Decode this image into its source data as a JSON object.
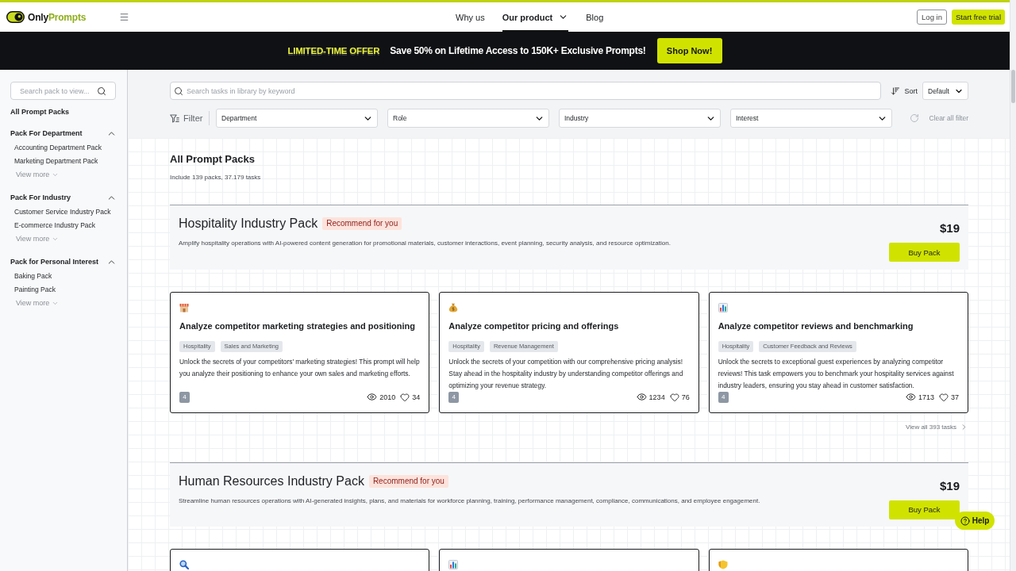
{
  "header": {
    "logo": [
      "Only",
      "Prompts"
    ],
    "nav": [
      {
        "label": "Why us",
        "kind": "link",
        "selected": false
      },
      {
        "label": "Our product",
        "kind": "menu",
        "selected": true
      },
      {
        "label": "Blog",
        "kind": "link",
        "selected": false
      }
    ],
    "login": "Log in",
    "trial": "Start free trial"
  },
  "banner": {
    "offer": "LIMITED-TIME OFFER",
    "message": "Save 50% on Lifetime Access to 150K+ Exclusive Prompts!",
    "button": "Shop Now!"
  },
  "sidebar": {
    "search": {
      "placeholder": "Search pack to view..."
    },
    "all_label": "All Prompt Packs",
    "groups": [
      {
        "title": "Pack For Department",
        "expanded": true,
        "items": [
          "Accounting Department Pack",
          "Marketing Department Pack"
        ],
        "more": "View more"
      },
      {
        "title": "Pack For Industry",
        "expanded": true,
        "items": [
          "Customer Service Industry Pack",
          "E-commerce Industry Pack"
        ],
        "more": "View more"
      },
      {
        "title": "Pack for Personal Interest",
        "expanded": true,
        "items": [
          "Baking Pack",
          "Painting Pack"
        ],
        "more": "View more"
      }
    ]
  },
  "filters": {
    "search": {
      "placeholder": "Search tasks in library by keyword"
    },
    "sort_label": "Sort",
    "sort_value": "Default",
    "filter_label": "Filter",
    "selects": [
      "Department",
      "Role",
      "Industry",
      "Interest"
    ],
    "clear": "Clear all filter",
    "clear_disabled": true
  },
  "content": {
    "title": "All Prompt Packs",
    "summary": "Include 139 packs, 37.179 tasks",
    "packs": [
      {
        "title": "Hospitality Industry Pack",
        "badge": "Recommend for you",
        "description": "Amplify hospitality operations with AI-powered content generation for promotional materials, customer interactions, event planning, security analysis, and resource optimization.",
        "price": "$19",
        "button": "Buy Pack",
        "tasks": [
          {
            "kind": "shop",
            "title": "Analyze competitor marketing strategies and positioning",
            "tags": [
              "Hospitality",
              "Sales and Marketing"
            ],
            "description": "Unlock the secrets of your competitors' marketing strategies! This prompt will help you analyze their positioning to enhance your own sales and marketing efforts.",
            "badge": "4",
            "views": "2010",
            "likes": "34"
          },
          {
            "kind": "money",
            "title": "Analyze competitor pricing and offerings",
            "tags": [
              "Hospitality",
              "Revenue Management"
            ],
            "description": "Unlock the secrets of your competition with our comprehensive pricing analysis! Stay ahead in the hospitality industry by understanding competitor offerings and optimizing your revenue strategy.",
            "badge": "4",
            "views": "1234",
            "likes": "76"
          },
          {
            "kind": "chart",
            "title": "Analyze competitor reviews and benchmarking",
            "tags": [
              "Hospitality",
              "Customer Feedback and Reviews"
            ],
            "description": "Unlock the secrets to exceptional guest experiences by analyzing competitor reviews! This task empowers you to benchmark your hospitality services against industry leaders, ensuring you stay ahead in customer satisfaction.",
            "badge": "4",
            "views": "1713",
            "likes": "37"
          }
        ],
        "view_all": "View all 393 tasks"
      },
      {
        "title": "Human Resources Industry Pack",
        "badge": "Recommend for you",
        "description": "Streamline human resources operations with AI-generated insights, plans, and materials for workforce planning, training, performance management, compliance, communications, and employee engagement.",
        "price": "$19",
        "button": "Buy Pack",
        "tasks": [
          {
            "kind": "search"
          },
          {
            "kind": "chart"
          },
          {
            "kind": "shield"
          }
        ]
      }
    ]
  },
  "help": "Help"
}
